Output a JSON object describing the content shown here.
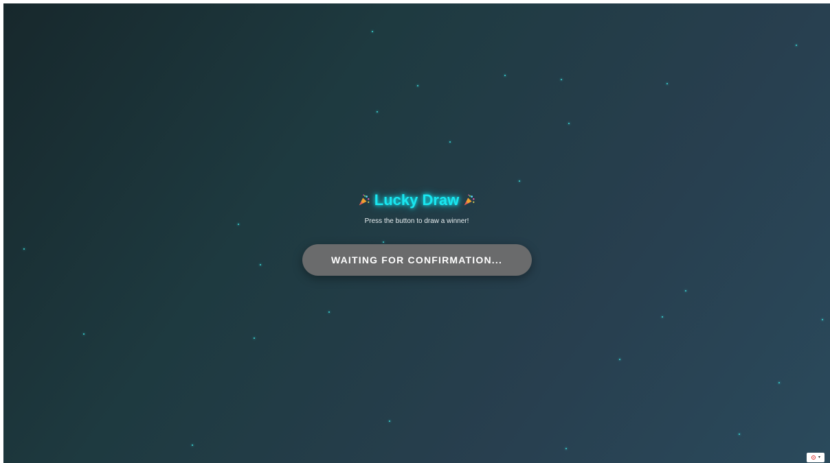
{
  "app": {
    "title": "Lucky Draw",
    "subtitle": "Press the button to draw a winner!",
    "title_icon": "party-popper-icon"
  },
  "draw_button": {
    "label": "WAITING FOR CONFIRMATION..."
  },
  "corner_widget": {
    "icon": "gear-icon",
    "caret_icon": "chevron-down-icon",
    "caret": "▾"
  },
  "colors": {
    "accent": "#19e6f0",
    "star": "#3ad6d6",
    "button": "#6a6b6c"
  }
}
